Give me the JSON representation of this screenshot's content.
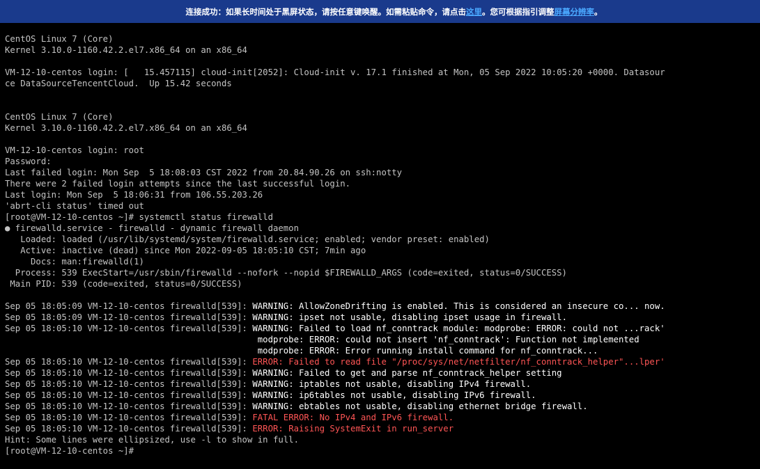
{
  "banner": {
    "text_before_link1": "连接成功：如果长时间处于黑屏状态，请按任意键唤醒。如需粘贴命令，请点击",
    "link1": "这里",
    "text_between": "。您可根据指引调整",
    "link2": "屏幕分辨率",
    "text_after": "。"
  },
  "terminal": {
    "lines": [
      {
        "s": [
          {
            "t": "CentOS Linux 7 (Core)",
            "c": "n"
          }
        ]
      },
      {
        "s": [
          {
            "t": "Kernel 3.10.0-1160.42.2.el7.x86_64 on an x86_64",
            "c": "n"
          }
        ]
      },
      {
        "s": []
      },
      {
        "s": [
          {
            "t": "VM-12-10-centos login: [   15.457115] cloud-init[2052]: Cloud-init v. 17.1 finished at Mon, 05 Sep 2022 10:05:20 +0000. Datasour",
            "c": "n"
          }
        ]
      },
      {
        "s": [
          {
            "t": "ce DataSourceTencentCloud.  Up 15.42 seconds",
            "c": "n"
          }
        ]
      },
      {
        "s": []
      },
      {
        "s": []
      },
      {
        "s": [
          {
            "t": "CentOS Linux 7 (Core)",
            "c": "n"
          }
        ]
      },
      {
        "s": [
          {
            "t": "Kernel 3.10.0-1160.42.2.el7.x86_64 on an x86_64",
            "c": "n"
          }
        ]
      },
      {
        "s": []
      },
      {
        "s": [
          {
            "t": "VM-12-10-centos login: root",
            "c": "n"
          }
        ]
      },
      {
        "s": [
          {
            "t": "Password:",
            "c": "n"
          }
        ]
      },
      {
        "s": [
          {
            "t": "Last failed login: Mon Sep  5 18:08:03 CST 2022 from 20.84.90.26 on ssh:notty",
            "c": "n"
          }
        ]
      },
      {
        "s": [
          {
            "t": "There were 2 failed login attempts since the last successful login.",
            "c": "n"
          }
        ]
      },
      {
        "s": [
          {
            "t": "Last login: Mon Sep  5 18:06:31 from 106.55.203.26",
            "c": "n"
          }
        ]
      },
      {
        "s": [
          {
            "t": "'abrt-cli status' timed out",
            "c": "n"
          }
        ]
      },
      {
        "s": [
          {
            "t": "[root@VM-12-10-centos ~]# systemctl status firewalld",
            "c": "n"
          }
        ]
      },
      {
        "s": [
          {
            "t": "● firewalld.service - firewalld - dynamic firewall daemon",
            "c": "n"
          }
        ]
      },
      {
        "s": [
          {
            "t": "   Loaded: loaded (/usr/lib/systemd/system/firewalld.service; enabled; vendor preset: enabled)",
            "c": "n"
          }
        ]
      },
      {
        "s": [
          {
            "t": "   Active: inactive (dead) since Mon 2022-09-05 18:05:10 CST; 7min ago",
            "c": "n"
          }
        ]
      },
      {
        "s": [
          {
            "t": "     Docs: man:firewalld(1)",
            "c": "n"
          }
        ]
      },
      {
        "s": [
          {
            "t": "  Process: 539 ExecStart=/usr/sbin/firewalld --nofork --nopid $FIREWALLD_ARGS (code=exited, status=0/SUCCESS)",
            "c": "n"
          }
        ]
      },
      {
        "s": [
          {
            "t": " Main PID: 539 (code=exited, status=0/SUCCESS)",
            "c": "n"
          }
        ]
      },
      {
        "s": []
      },
      {
        "s": [
          {
            "t": "Sep 05 18:05:09 VM-12-10-centos firewalld[539]: ",
            "c": "n"
          },
          {
            "t": "WARNING: AllowZoneDrifting is enabled. This is considered an insecure co... now.",
            "c": "w"
          }
        ]
      },
      {
        "s": [
          {
            "t": "Sep 05 18:05:09 VM-12-10-centos firewalld[539]: ",
            "c": "n"
          },
          {
            "t": "WARNING: ipset not usable, disabling ipset usage in firewall.",
            "c": "w"
          }
        ]
      },
      {
        "s": [
          {
            "t": "Sep 05 18:05:10 VM-12-10-centos firewalld[539]: ",
            "c": "n"
          },
          {
            "t": "WARNING: Failed to load nf_conntrack module: modprobe: ERROR: could not ...rack'",
            "c": "w"
          }
        ]
      },
      {
        "s": [
          {
            "t": "                                                 ",
            "c": "n"
          },
          {
            "t": "modprobe: ERROR: could not insert 'nf_conntrack': Function not implemented",
            "c": "w"
          }
        ]
      },
      {
        "s": [
          {
            "t": "                                                 ",
            "c": "n"
          },
          {
            "t": "modprobe: ERROR: Error running install command for nf_conntrack...",
            "c": "w"
          }
        ]
      },
      {
        "s": [
          {
            "t": "Sep 05 18:05:10 VM-12-10-centos firewalld[539]: ",
            "c": "n"
          },
          {
            "t": "ERROR: Failed to read file \"/proc/sys/net/netfilter/nf_conntrack_helper\"...lper'",
            "c": "r"
          }
        ]
      },
      {
        "s": [
          {
            "t": "Sep 05 18:05:10 VM-12-10-centos firewalld[539]: ",
            "c": "n"
          },
          {
            "t": "WARNING: Failed to get and parse nf_conntrack_helper setting",
            "c": "w"
          }
        ]
      },
      {
        "s": [
          {
            "t": "Sep 05 18:05:10 VM-12-10-centos firewalld[539]: ",
            "c": "n"
          },
          {
            "t": "WARNING: iptables not usable, disabling IPv4 firewall.",
            "c": "w"
          }
        ]
      },
      {
        "s": [
          {
            "t": "Sep 05 18:05:10 VM-12-10-centos firewalld[539]: ",
            "c": "n"
          },
          {
            "t": "WARNING: ip6tables not usable, disabling IPv6 firewall.",
            "c": "w"
          }
        ]
      },
      {
        "s": [
          {
            "t": "Sep 05 18:05:10 VM-12-10-centos firewalld[539]: ",
            "c": "n"
          },
          {
            "t": "WARNING: ebtables not usable, disabling ethernet bridge firewall.",
            "c": "w"
          }
        ]
      },
      {
        "s": [
          {
            "t": "Sep 05 18:05:10 VM-12-10-centos firewalld[539]: ",
            "c": "n"
          },
          {
            "t": "FATAL ERROR: No IPv4 and IPv6 firewall.",
            "c": "r"
          }
        ]
      },
      {
        "s": [
          {
            "t": "Sep 05 18:05:10 VM-12-10-centos firewalld[539]: ",
            "c": "n"
          },
          {
            "t": "ERROR: Raising SystemExit in run_server",
            "c": "r"
          }
        ]
      },
      {
        "s": [
          {
            "t": "Hint: Some lines were ellipsized, use -l to show in full.",
            "c": "n"
          }
        ]
      },
      {
        "s": [
          {
            "t": "[root@VM-12-10-centos ~]#",
            "c": "n"
          }
        ]
      }
    ]
  },
  "colors": {
    "banner_bg": "#1a3a8c",
    "banner_link": "#4aa8ff",
    "terminal_bg": "#000000",
    "text_normal": "#c4c4c4",
    "text_warning": "#ffffff",
    "text_error": "#ff5555"
  }
}
